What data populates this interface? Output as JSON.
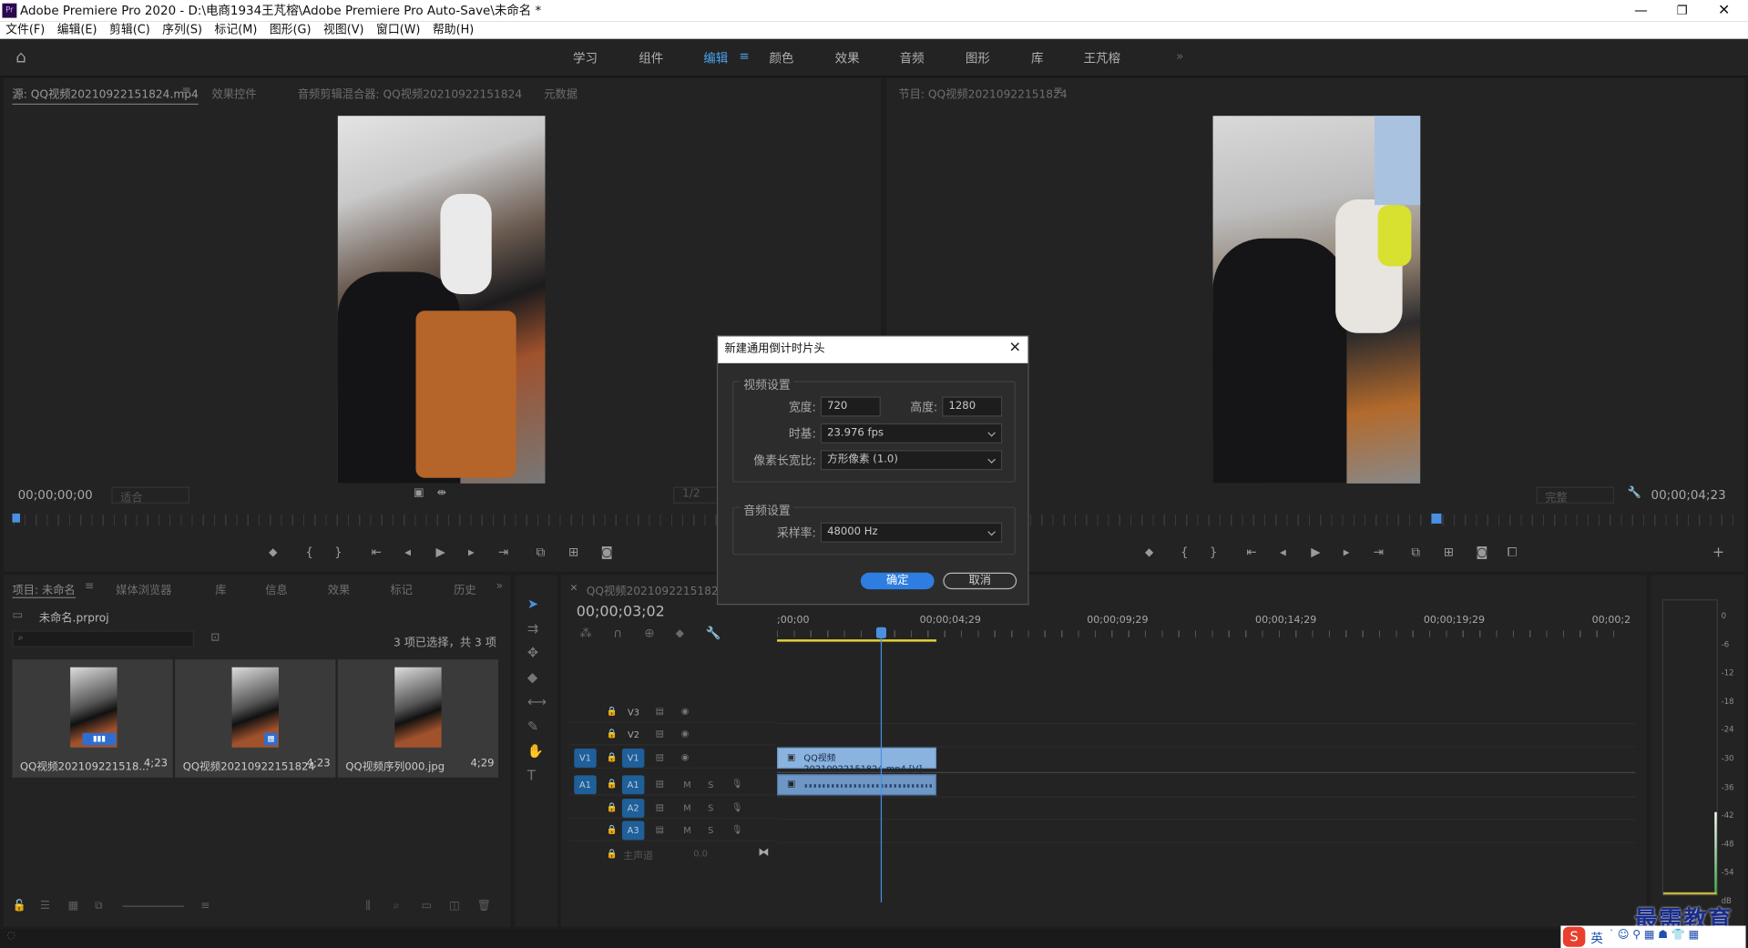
{
  "app": {
    "title": "Adobe Premiere Pro 2020 - D:\\电商1934王芃榕\\Adobe Premiere Pro Auto-Save\\未命名 *",
    "logo": "Pr"
  },
  "menu": [
    "文件(F)",
    "编辑(E)",
    "剪辑(C)",
    "序列(S)",
    "标记(M)",
    "图形(G)",
    "视图(V)",
    "窗口(W)",
    "帮助(H)"
  ],
  "workspaces": [
    "学习",
    "组件",
    "编辑",
    "颜色",
    "效果",
    "音频",
    "图形",
    "库",
    "王芃榕"
  ],
  "source": {
    "tabs": [
      "源: QQ视频20210922151824.mp4",
      "效果控件",
      "音频剪辑混合器: QQ视频20210922151824",
      "元数据"
    ],
    "timecode": "00;00;00;00",
    "fit": "适合",
    "ratio": "1/2"
  },
  "program": {
    "tab": "节目: QQ视频20210922151824",
    "timecode": "00;00;04;23",
    "quality": "完整"
  },
  "dialog": {
    "title": "新建通用倒计时片头",
    "video_section": "视频设置",
    "width_label": "宽度:",
    "width": "720",
    "height_label": "高度:",
    "height": "1280",
    "timebase_label": "时基:",
    "timebase": "23.976 fps",
    "par_label": "像素长宽比:",
    "par": "方形像素 (1.0)",
    "audio_section": "音频设置",
    "rate_label": "采样率:",
    "rate": "48000 Hz",
    "ok": "确定",
    "cancel": "取消"
  },
  "project": {
    "tabs": [
      "项目: 未命名",
      "媒体浏览器",
      "库",
      "信息",
      "效果",
      "标记",
      "历史"
    ],
    "file": "未命名.prproj",
    "status": "3 项已选择，共 3 项",
    "items": [
      {
        "name": "QQ视频202109221518...",
        "dur": "4;23"
      },
      {
        "name": "QQ视频20210922151824",
        "dur": "4;23"
      },
      {
        "name": "QQ视频序列000.jpg",
        "dur": "4;29"
      }
    ]
  },
  "timeline": {
    "tab": "QQ视频20210922151824",
    "timecode": "00;00;03;02",
    "ruler": [
      ";00;00",
      "00;00;04;29",
      "00;00;09;29",
      "00;00;14;29",
      "00;00;19;29",
      "00;00;2"
    ],
    "tracks": {
      "v3": "V3",
      "v2": "V2",
      "v1": "V1",
      "a1": "A1",
      "a2": "A2",
      "a3": "A3",
      "master": "主声道",
      "master_val": "0.0",
      "m": "M",
      "s": "S"
    },
    "clip": "QQ视频20210922151824.mp4 [V]"
  },
  "meter": [
    "0",
    "-6",
    "-12",
    "-18",
    "-24",
    "-30",
    "-36",
    "-42",
    "-48",
    "-54",
    "dB"
  ],
  "watermark": "最需教育",
  "ime": "英"
}
